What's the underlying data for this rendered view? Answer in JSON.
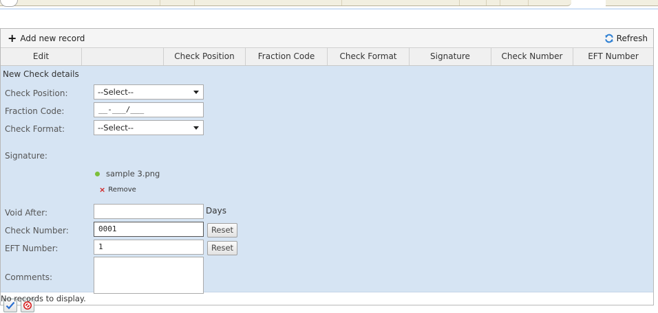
{
  "toolbar": {
    "add_label": "Add new record",
    "refresh_label": "Refresh"
  },
  "columns": [
    "Edit",
    "",
    "Check Position",
    "Fraction Code",
    "Check Format",
    "Signature",
    "Check Number",
    "EFT Number"
  ],
  "form": {
    "title": "New Check details",
    "labels": {
      "check_position": "Check Position:",
      "fraction_code": "Fraction Code:",
      "check_format": "Check Format:",
      "signature": "Signature:",
      "void_after": "Void After:",
      "check_number": "Check Number:",
      "eft_number": "EFT Number:",
      "comments": "Comments:"
    },
    "values": {
      "check_position": "--Select--",
      "fraction_code": "__-___/___",
      "check_format": "--Select--",
      "signature_file": "sample 3.png",
      "void_after": "",
      "check_number": "0001",
      "eft_number": "1",
      "comments": ""
    },
    "days_label": "Days",
    "remove_label": "Remove",
    "reset_label": "Reset"
  },
  "status": {
    "no_records": "No records to display."
  },
  "colors": {
    "form_bg": "#d6e4f3",
    "header_bg": "#f0f0f0",
    "status_dot": "#7cbf3a",
    "remove_x": "#d02020",
    "save_check": "#2a6fd0",
    "cancel_red": "#d61a1a"
  }
}
